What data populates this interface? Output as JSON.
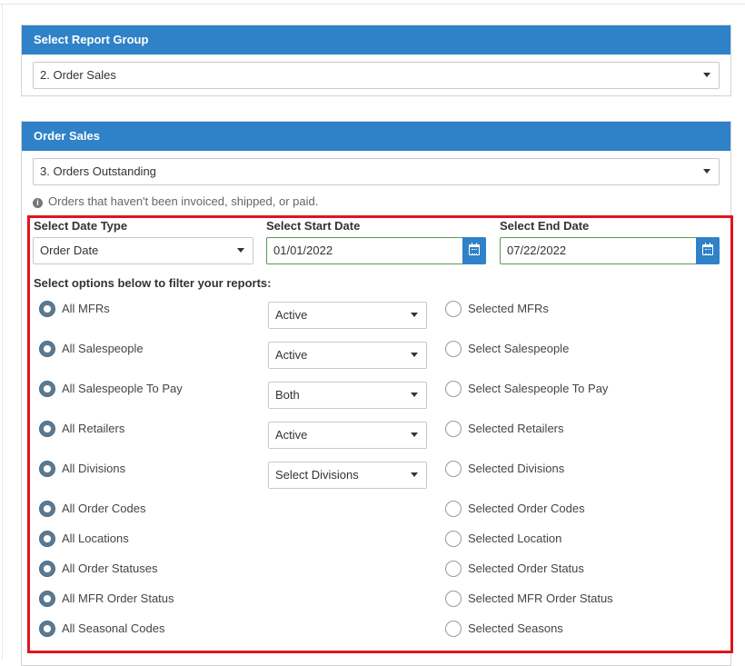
{
  "report_group": {
    "title": "Select Report Group",
    "selected": "2. Order Sales"
  },
  "order_sales": {
    "title": "Order Sales",
    "selected": "3. Orders Outstanding",
    "info": "Orders that haven't been invoiced, shipped, or paid."
  },
  "date_type": {
    "label": "Select Date Type",
    "selected": "Order Date"
  },
  "start_date": {
    "label": "Select Start Date",
    "value": "01/01/2022"
  },
  "end_date": {
    "label": "Select End Date",
    "value": "07/22/2022"
  },
  "filter_heading": "Select options below to filter your reports:",
  "filters": [
    {
      "all_label": "All MFRs",
      "all_checked": true,
      "dropdown": "Active",
      "selected_label": "Selected MFRs",
      "selected_checked": false
    },
    {
      "all_label": "All Salespeople",
      "all_checked": true,
      "dropdown": "Active",
      "selected_label": "Select Salespeople",
      "selected_checked": false
    },
    {
      "all_label": "All Salespeople To Pay",
      "all_checked": true,
      "dropdown": "Both",
      "selected_label": "Select Salespeople To Pay",
      "selected_checked": false
    },
    {
      "all_label": "All Retailers",
      "all_checked": true,
      "dropdown": "Active",
      "selected_label": "Selected Retailers",
      "selected_checked": false
    },
    {
      "all_label": "All Divisions",
      "all_checked": true,
      "dropdown": "Select Divisions",
      "selected_label": "Selected Divisions",
      "selected_checked": false
    },
    {
      "all_label": "All Order Codes",
      "all_checked": true,
      "selected_label": "Selected Order Codes",
      "selected_checked": false
    },
    {
      "all_label": "All Locations",
      "all_checked": true,
      "selected_label": "Selected Location",
      "selected_checked": false
    },
    {
      "all_label": "All Order Statuses",
      "all_checked": true,
      "selected_label": "Selected Order Status",
      "selected_checked": false
    },
    {
      "all_label": "All MFR Order Status",
      "all_checked": true,
      "selected_label": "Selected MFR Order Status",
      "selected_checked": false
    },
    {
      "all_label": "All Seasonal Codes",
      "all_checked": true,
      "selected_label": "Selected Seasons",
      "selected_checked": false
    }
  ],
  "colors": {
    "header_blue": "#2f82c7",
    "highlight_red": "#e0141e",
    "radio_checked": "#5b7a92",
    "date_border_green": "#5a9a55"
  },
  "icons": {
    "info": "info-circle-icon",
    "calendar": "calendar-icon",
    "dropdown": "chevron-down-icon"
  }
}
